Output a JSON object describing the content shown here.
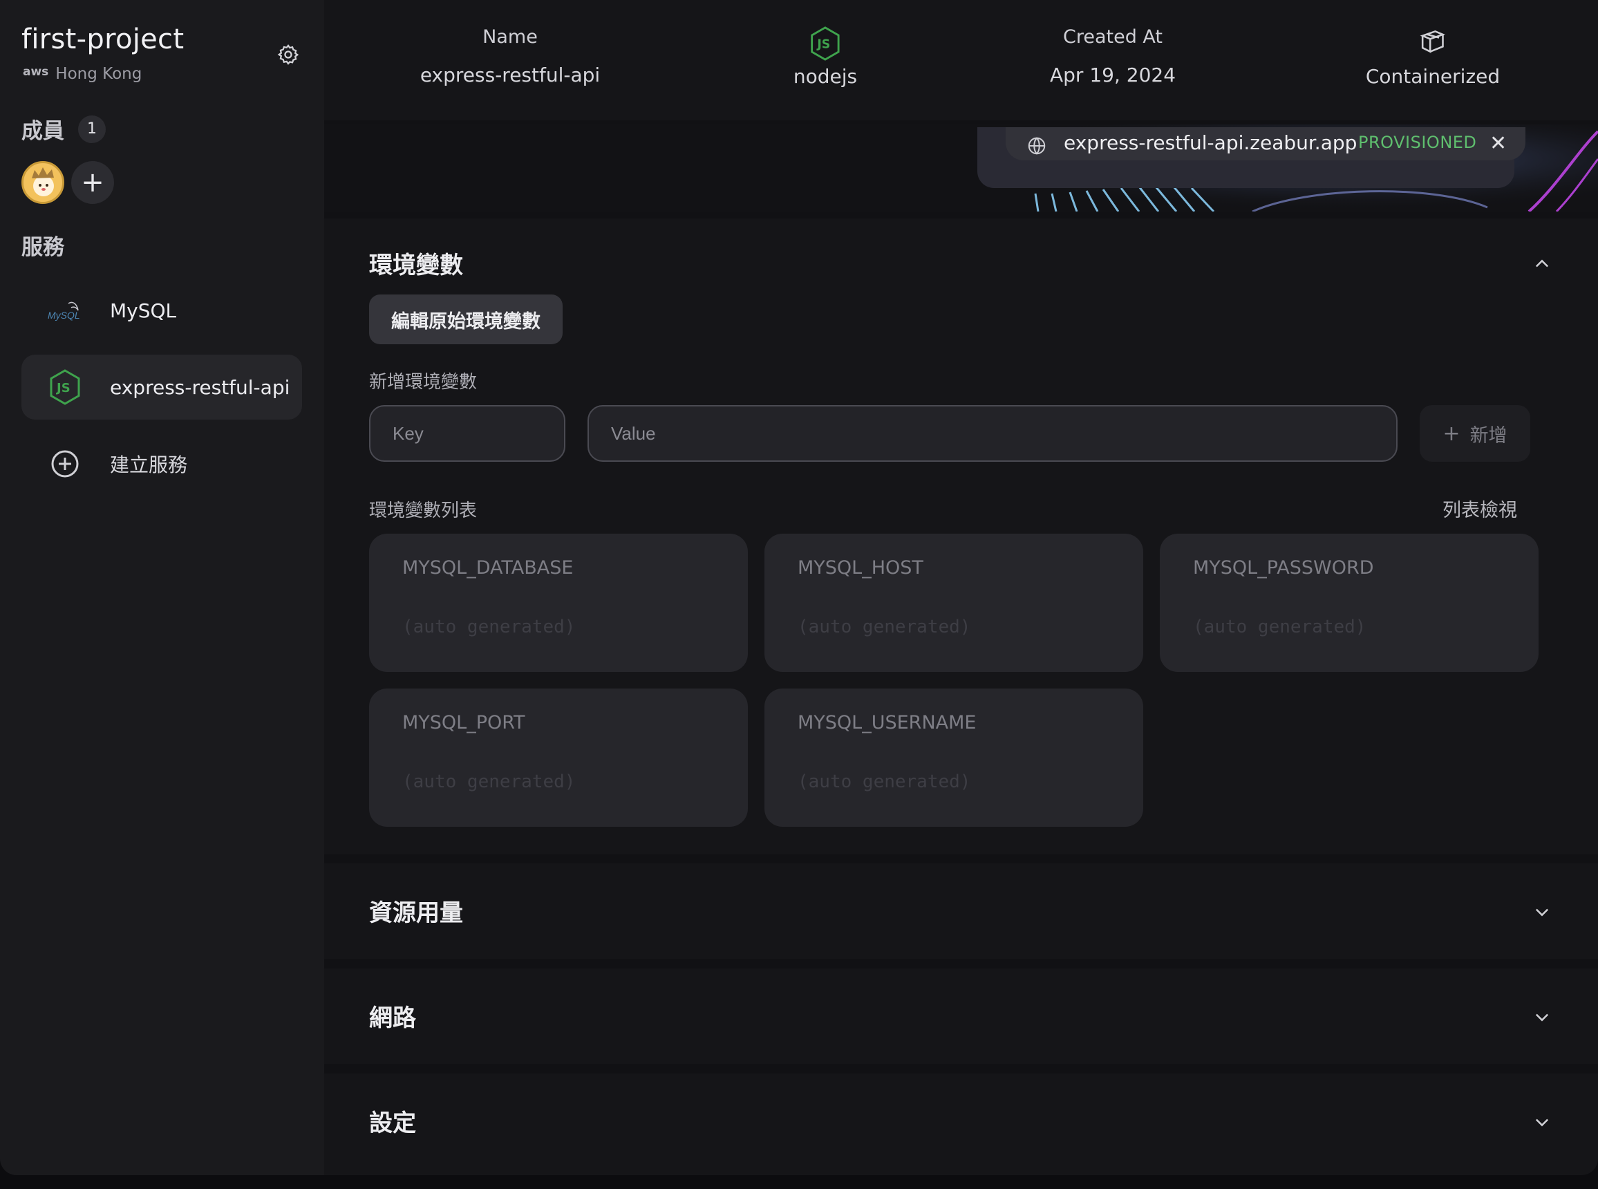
{
  "sidebar": {
    "project_name": "first-project",
    "region_provider": "aws",
    "region": "Hong Kong",
    "members_label": "成員",
    "members_count": "1",
    "services_label": "服務",
    "services": [
      {
        "name": "MySQL",
        "icon": "mysql-icon",
        "active": false
      },
      {
        "name": "express-restful-api",
        "icon": "nodejs-icon",
        "active": true
      }
    ],
    "create_service_label": "建立服務"
  },
  "header": {
    "name_label": "Name",
    "name_value": "express-restful-api",
    "runtime_icon": "nodejs-icon",
    "runtime_value": "nodejs",
    "created_label": "Created At",
    "created_value": "Apr 19, 2024",
    "deploy_icon": "box-icon",
    "deploy_value": "Containerized"
  },
  "domain": {
    "url": "express-restful-api.zeabur.app",
    "status": "PROVISIONED",
    "status_color": "#5fbf6e"
  },
  "env": {
    "title": "環境變數",
    "edit_raw_label": "編輯原始環境變數",
    "add_label": "新增環境變數",
    "key_placeholder": "Key",
    "value_placeholder": "Value",
    "add_button": "新增",
    "list_label": "環境變數列表",
    "list_view_label": "列表檢視",
    "variables": [
      {
        "name": "MYSQL_DATABASE",
        "value": "(auto generated)"
      },
      {
        "name": "MYSQL_HOST",
        "value": "(auto generated)"
      },
      {
        "name": "MYSQL_PASSWORD",
        "value": "(auto generated)"
      },
      {
        "name": "MYSQL_PORT",
        "value": "(auto generated)"
      },
      {
        "name": "MYSQL_USERNAME",
        "value": "(auto generated)"
      }
    ]
  },
  "sections": {
    "resources": "資源用量",
    "network": "網路",
    "settings": "設定"
  },
  "colors": {
    "accent_green": "#5fbf6e",
    "node_green": "#3fa34d"
  }
}
